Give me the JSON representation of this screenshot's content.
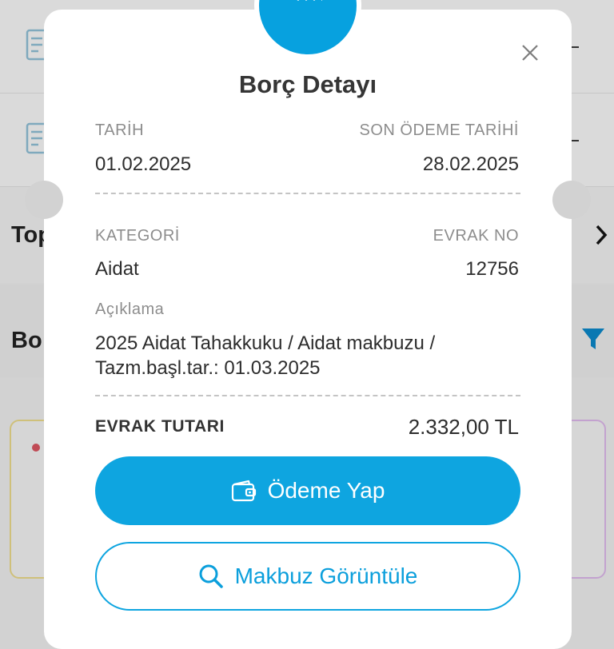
{
  "background": {
    "section_heading_1": "Top",
    "section_heading_2": "Bo",
    "accent_color": "#07a1df"
  },
  "modal": {
    "title": "Borç Detayı",
    "icons": {
      "header": "receipt-icon",
      "close": "close-icon",
      "pay": "wallet-icon",
      "receipt": "search-icon"
    },
    "date_label": "TARİH",
    "date_value": "01.02.2025",
    "due_date_label": "SON ÖDEME TARİHİ",
    "due_date_value": "28.02.2025",
    "category_label": "KATEGORİ",
    "category_value": "Aidat",
    "document_no_label": "EVRAK NO",
    "document_no_value": "12756",
    "description_label": "Açıklama",
    "description_value": "2025 Aidat Tahakkuku / Aidat makbuzu / Tazm.başl.tar.: 01.03.2025",
    "total_label": "EVRAK TUTARI",
    "total_value": "2.332,00 TL",
    "pay_button_label": "Ödeme Yap",
    "view_receipt_button_label": "Makbuz Görüntüle"
  }
}
